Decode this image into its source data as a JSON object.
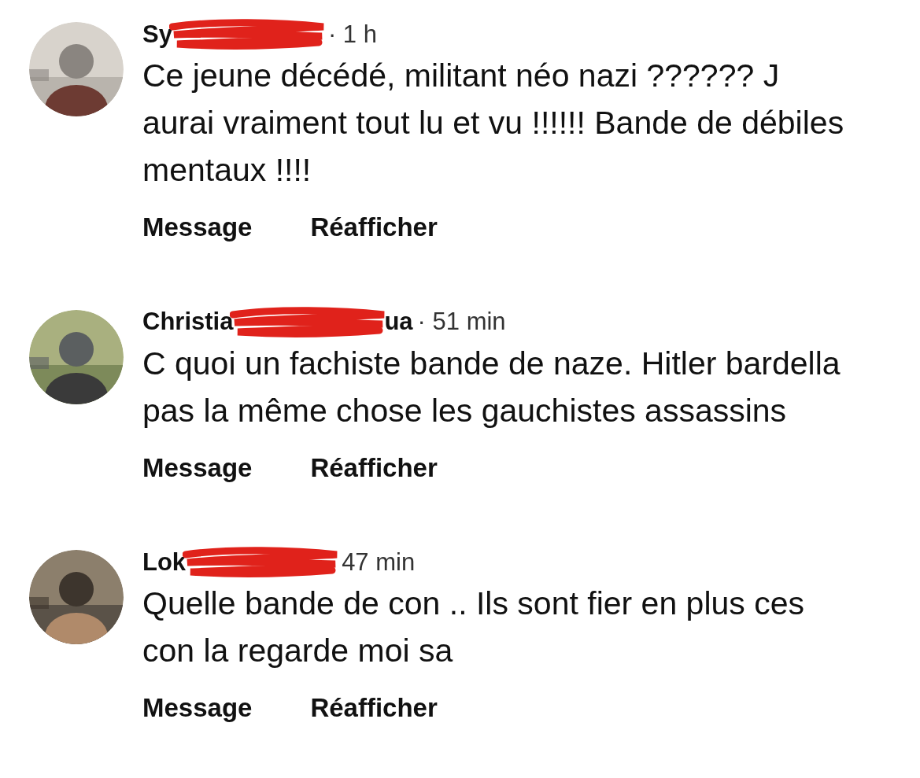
{
  "comments": [
    {
      "name": "Sy",
      "time": "· 1 h",
      "text": "Ce jeune décédé, militant néo nazi ?????? J aurai vraiment tout lu et vu !!!!!! Bande de débiles mentaux !!!!",
      "actions": [
        "Message",
        "Réafficher"
      ]
    },
    {
      "name": "Christia",
      "name_end": "ua",
      "time": "· 51 min",
      "text": "C quoi un fachiste bande de naze. Hitler bardella pas la même chose les gauchistes assassins",
      "actions": [
        "Message",
        "Réafficher"
      ]
    },
    {
      "name": "Lok",
      "time": "47 min",
      "text": "Quelle bande de con ..  Ils sont fier en plus ces con la regarde moi sa",
      "actions": [
        "Message",
        "Réafficher"
      ]
    }
  ]
}
